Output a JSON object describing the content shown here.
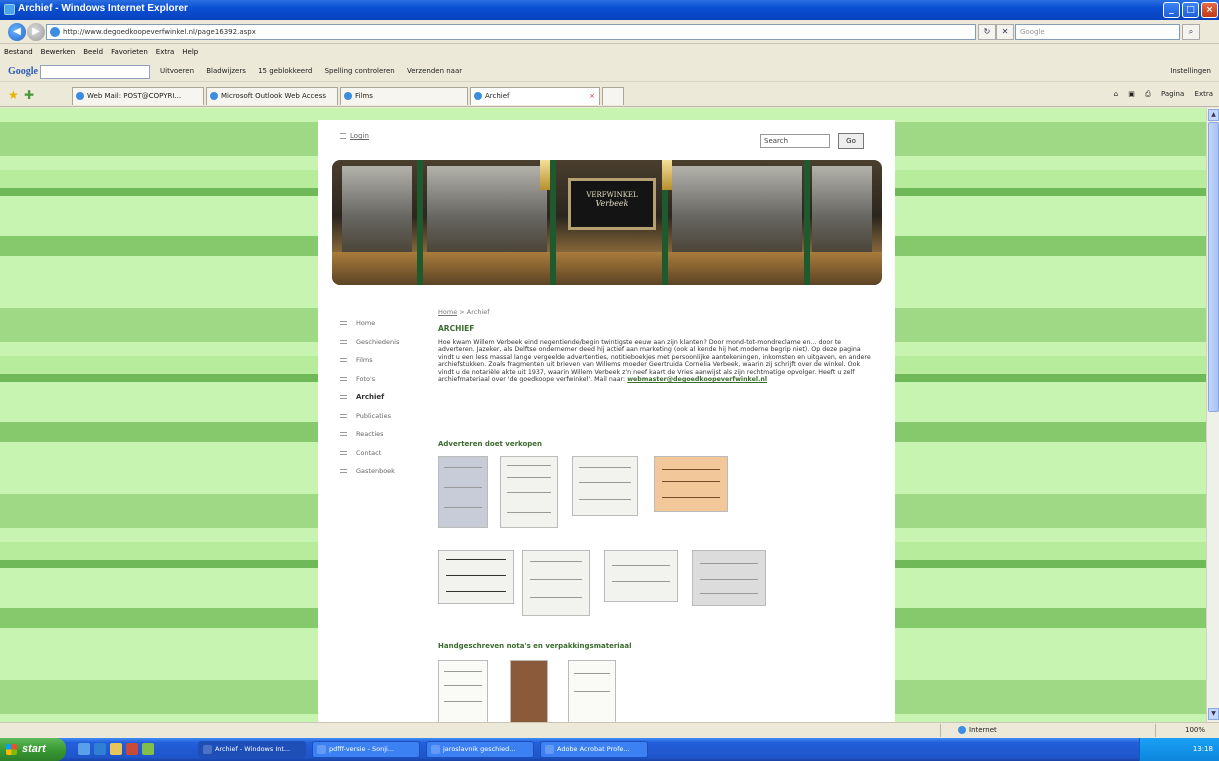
{
  "window": {
    "title": "Archief - Windows Internet Explorer"
  },
  "address": {
    "url": "http://www.degoedkoopeverfwinkel.nl/page16392.aspx",
    "search_placeholder": "Google"
  },
  "menu": [
    "Bestand",
    "Bewerken",
    "Beeld",
    "Favorieten",
    "Extra",
    "Help"
  ],
  "google_toolbar": {
    "logo": "Google",
    "items": [
      "Uitvoeren",
      "Bladwijzers",
      "15 geblokkeerd",
      "Spelling controleren",
      "Verzenden naar"
    ],
    "settings": "Instellingen"
  },
  "tabs": [
    {
      "label": "Web Mail: POST@COPYRI..."
    },
    {
      "label": "Microsoft Outlook Web Access"
    },
    {
      "label": "Films"
    },
    {
      "label": "Archief"
    }
  ],
  "tab_tools": [
    "Pagina",
    "Extra"
  ],
  "page": {
    "login": "Login",
    "search_value": "Search",
    "go": "Go",
    "banner": {
      "sign_line1": "VERFWINKEL",
      "sign_line2": "Verbeek"
    },
    "nav": [
      {
        "label": "Home",
        "active": false
      },
      {
        "label": "Geschiedenis",
        "active": false
      },
      {
        "label": "Films",
        "active": false
      },
      {
        "label": "Foto's",
        "active": false
      },
      {
        "label": "Archief",
        "active": true
      },
      {
        "label": "Publicaties",
        "active": false
      },
      {
        "label": "Reacties",
        "active": false
      },
      {
        "label": "Contact",
        "active": false
      },
      {
        "label": "Gastenboek",
        "active": false
      }
    ],
    "breadcrumb": {
      "home": "Home",
      "sep": " > ",
      "current": "Archief"
    },
    "heading": "ARCHIEF",
    "intro": "Hoe kwam Willem Verbeek eind negentiende/begin twintigste eeuw aan zijn klanten? Door mond-tot-mondreclame en... door te adverteren. Jazeker, als Delftse ondernemer deed hij actief aan marketing (ook al kende hij het moderne begrip niet). Op deze pagina vindt u een less massal lange vergeelde advertenties, notitieboekjes met persoonlijke aantekeningen, inkomsten en uitgaven, en andere archiefstukken. Zoals fragmenten uit brieven van Willems moeder Geertruida Cornelia Verbeek, waarin zij schrijft over de winkel. Ook vindt u de notariële akte uit 1937, waarin Willem Verbeek z'n neef kaart de Vries aanwijst als zijn rechtmatige opvolger. Heeft u zelf archiefmateriaal over 'de goedkoope verfwinkel'. Mail naar:",
    "email": "webmaster@degoedkoopeverfwinkel.nl",
    "section_ads": "Adverteren doet verkopen",
    "section_notes": "Handgeschreven nota's en verpakkingsmateriaal"
  },
  "status": {
    "zone": "Internet",
    "zoom": "100%"
  },
  "taskbar": {
    "start": "start",
    "tasks": [
      {
        "label": "Archief - Windows Int..."
      },
      {
        "label": "pdfff-versie - Sonji..."
      },
      {
        "label": "jaroslavnik geschied..."
      },
      {
        "label": "Adobe Acrobat Profe..."
      }
    ],
    "clock": "13:18"
  },
  "colors": {
    "accent": "#3a6a2e",
    "stripe_light": "#c7f5b1",
    "stripe_dark": "#6fb959",
    "titlebar": "#0a4fd3"
  }
}
